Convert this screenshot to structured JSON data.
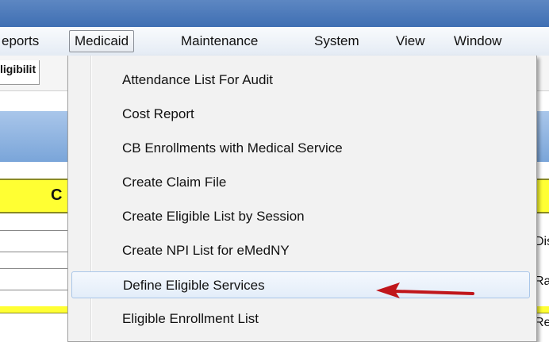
{
  "menubar": {
    "items": [
      {
        "label": "eports"
      },
      {
        "label": "Medicaid"
      },
      {
        "label": "Maintenance"
      },
      {
        "label": "System"
      },
      {
        "label": "View"
      },
      {
        "label": "Window"
      }
    ]
  },
  "toolbar": {
    "tab_label": "ligibilit"
  },
  "background": {
    "panel_letter": "C",
    "right_fragments": [
      "Dis",
      "Ra",
      "Re"
    ]
  },
  "medicaid_menu": {
    "items": [
      {
        "label": "Attendance List For Audit"
      },
      {
        "label": "Cost Report"
      },
      {
        "label": "CB Enrollments with Medical Service"
      },
      {
        "label": "Create Claim File"
      },
      {
        "label": "Create Eligible List by Session"
      },
      {
        "label": "Create NPI List for eMedNY"
      },
      {
        "label": "Define Eligible Services"
      },
      {
        "label": "Eligible Enrollment List"
      }
    ]
  },
  "colors": {
    "arrow": "#c0161b",
    "title_bar": "#4a78b9",
    "highlight": "#ffff33"
  },
  "annotation": {
    "icon": "red-arrow-left"
  }
}
